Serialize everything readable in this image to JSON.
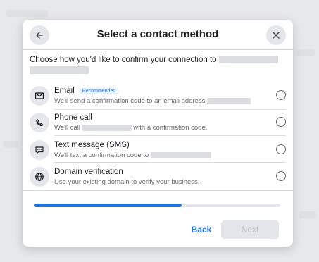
{
  "dialog": {
    "title": "Select a contact method",
    "prompt": "Choose how you'd like to confirm your connection to"
  },
  "options": [
    {
      "title": "Email",
      "badge": "Recommended",
      "desc": "We'll send a confirmation code to an email address",
      "icon": "envelope-icon"
    },
    {
      "title": "Phone call",
      "desc_prefix": "We'll call",
      "desc_suffix": "with a confirmation code.",
      "icon": "phone-icon"
    },
    {
      "title": "Text message (SMS)",
      "desc": "We'll text a confirmation code to",
      "icon": "chat-icon"
    },
    {
      "title": "Domain verification",
      "desc": "Use your existing domain to verify your business.",
      "icon": "globe-icon"
    }
  ],
  "progress": {
    "fraction": 0.6
  },
  "footer": {
    "back_label": "Back",
    "next_label": "Next"
  },
  "colors": {
    "accent": "#1b74e4",
    "disabled_bg": "#e4e6eb",
    "disabled_text": "#bcc0c4"
  }
}
